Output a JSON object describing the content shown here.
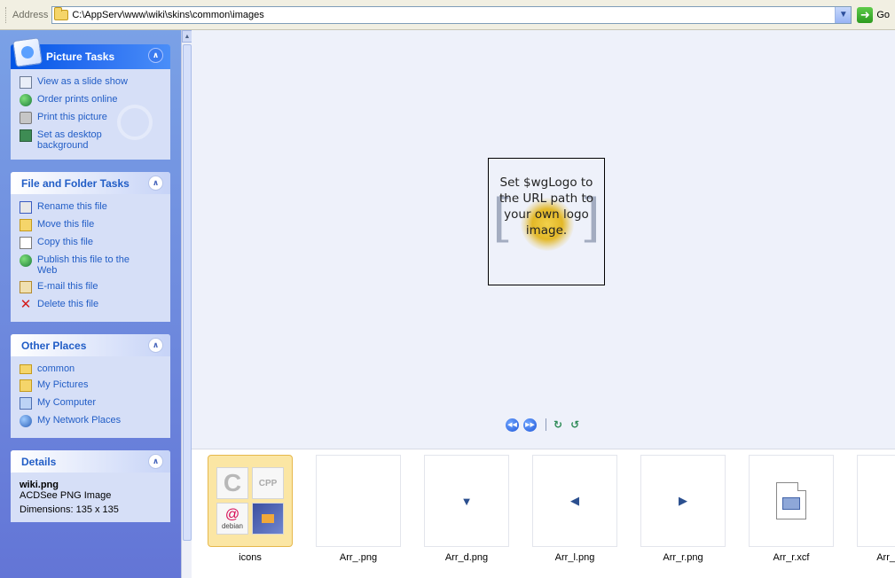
{
  "address": {
    "label": "Address",
    "path": "C:\\AppServ\\www\\wiki\\skins\\common\\images",
    "go_label": "Go"
  },
  "sidebar": {
    "picture_tasks": {
      "title": "Picture Tasks",
      "items": [
        {
          "label": "View as a slide show",
          "icon": "slideshow-icon"
        },
        {
          "label": "Order prints online",
          "icon": "globe-icon"
        },
        {
          "label": "Print this picture",
          "icon": "printer-icon"
        },
        {
          "label": "Set as desktop background",
          "icon": "desktop-icon"
        }
      ]
    },
    "file_tasks": {
      "title": "File and Folder Tasks",
      "items": [
        {
          "label": "Rename this file",
          "icon": "rename-icon"
        },
        {
          "label": "Move this file",
          "icon": "move-icon"
        },
        {
          "label": "Copy this file",
          "icon": "copy-icon"
        },
        {
          "label": "Publish this file to the Web",
          "icon": "publish-icon"
        },
        {
          "label": "E-mail this file",
          "icon": "email-icon"
        },
        {
          "label": "Delete this file",
          "icon": "delete-icon"
        }
      ]
    },
    "other_places": {
      "title": "Other Places",
      "items": [
        {
          "label": "common",
          "icon": "folder-icon"
        },
        {
          "label": "My Pictures",
          "icon": "my-pictures-icon"
        },
        {
          "label": "My Computer",
          "icon": "my-computer-icon"
        },
        {
          "label": "My Network Places",
          "icon": "network-places-icon"
        }
      ]
    },
    "details": {
      "title": "Details",
      "filename": "wiki.png",
      "type": "ACDSee PNG Image",
      "dimensions": "Dimensions: 135 x 135"
    }
  },
  "preview": {
    "logo_text": "Set $wgLogo to the URL path to your own logo image."
  },
  "filmstrip": {
    "items": [
      {
        "label": "icons",
        "kind": "folder"
      },
      {
        "label": "Arr_.png",
        "kind": "blank"
      },
      {
        "label": "Arr_d.png",
        "kind": "arrow-down"
      },
      {
        "label": "Arr_l.png",
        "kind": "arrow-left"
      },
      {
        "label": "Arr_r.png",
        "kind": "arrow-right"
      },
      {
        "label": "Arr_r.xcf",
        "kind": "document"
      },
      {
        "label": "Arr_",
        "kind": "partial"
      }
    ],
    "folder_thumbs": {
      "cpp": "CPP",
      "debian": "debian"
    }
  }
}
